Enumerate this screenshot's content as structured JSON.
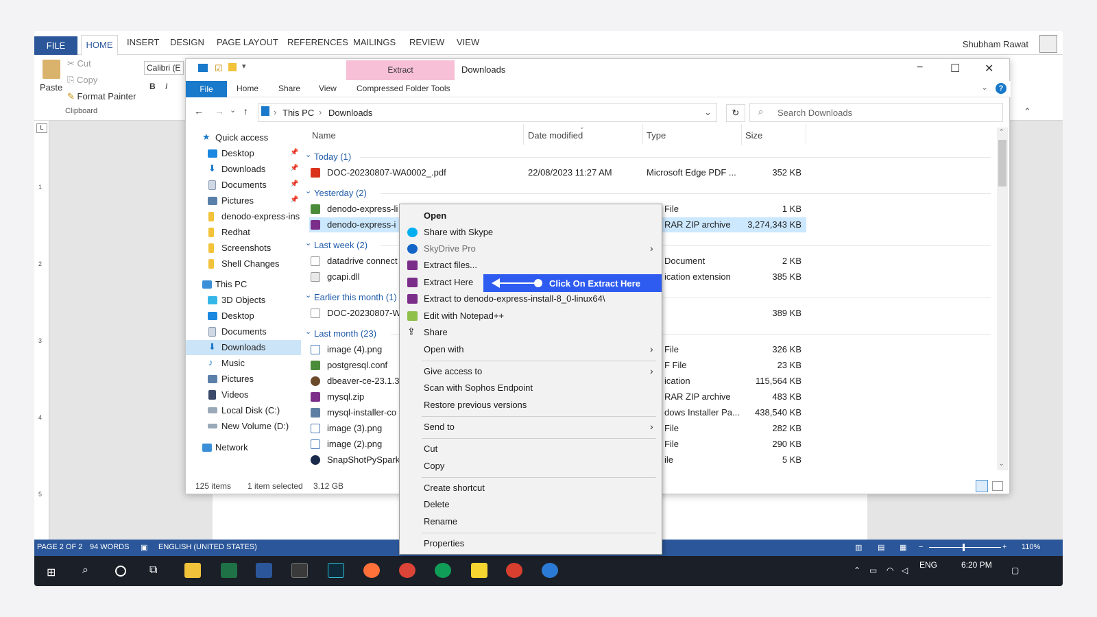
{
  "word": {
    "tabs": [
      "FILE",
      "HOME",
      "INSERT",
      "DESIGN",
      "PAGE LAYOUT",
      "REFERENCES",
      "MAILINGS",
      "REVIEW",
      "VIEW"
    ],
    "user": "Shubham Rawat",
    "clipboard": {
      "paste": "Paste",
      "cut": "Cut",
      "copy": "Copy",
      "format_painter": "Format Painter",
      "group": "Clipboard"
    },
    "font_box": "Calibri (E",
    "status": {
      "page": "PAGE 2 OF 2",
      "words": "94 WORDS",
      "lang": "ENGLISH (UNITED STATES)",
      "zoom": "110%"
    },
    "ruler_marks": [
      "1",
      "2",
      "3",
      "4",
      "5"
    ]
  },
  "taskbar": {
    "lang": "ENG",
    "time": "6:20 PM"
  },
  "explorer": {
    "title": "Downloads",
    "extract_tab": "Extract",
    "ribbon_tabs": [
      "File",
      "Home",
      "Share",
      "View",
      "Compressed Folder Tools"
    ],
    "breadcrumb": [
      "This PC",
      "Downloads"
    ],
    "search_placeholder": "Search Downloads",
    "columns": [
      "Name",
      "Date modified",
      "Type",
      "Size"
    ],
    "nav": {
      "quick_access": "Quick access",
      "quick_items": [
        "Desktop",
        "Downloads",
        "Documents",
        "Pictures",
        "denodo-express-ins",
        "Redhat",
        "Screenshots",
        "Shell Changes"
      ],
      "this_pc": "This PC",
      "pc_items": [
        "3D Objects",
        "Desktop",
        "Documents",
        "Downloads",
        "Music",
        "Pictures",
        "Videos",
        "Local Disk (C:)",
        "New Volume (D:)"
      ],
      "network": "Network"
    },
    "groups": {
      "today": "Today (1)",
      "yesterday": "Yesterday (2)",
      "last_week": "Last week (2)",
      "earlier": "Earlier this month (1)",
      "last_month": "Last month (23)"
    },
    "files": {
      "today": [
        {
          "name": "DOC-20230807-WA0002_.pdf",
          "date": "22/08/2023 11:27 AM",
          "type": "Microsoft Edge PDF ...",
          "size": "352 KB"
        }
      ],
      "yesterday": [
        {
          "name": "denodo-express-li",
          "type": "File",
          "size": "1 KB"
        },
        {
          "name": "denodo-express-i",
          "type": "RAR ZIP archive",
          "size": "3,274,343 KB"
        }
      ],
      "last_week": [
        {
          "name": "datadrive connect",
          "type": "Document",
          "size": "2 KB"
        },
        {
          "name": "gcapi.dll",
          "type": "ication extension",
          "size": "385 KB"
        }
      ],
      "earlier": [
        {
          "name": "DOC-20230807-W",
          "type": "",
          "size": "389 KB"
        }
      ],
      "last_month": [
        {
          "name": "image (4).png",
          "type": "File",
          "size": "326 KB"
        },
        {
          "name": "postgresql.conf",
          "type": "F File",
          "size": "23 KB"
        },
        {
          "name": "dbeaver-ce-23.1.3",
          "type": "ication",
          "size": "115,564 KB"
        },
        {
          "name": "mysql.zip",
          "type": "RAR ZIP archive",
          "size": "483 KB"
        },
        {
          "name": "mysql-installer-co",
          "type": "dows Installer Pa...",
          "size": "438,540 KB"
        },
        {
          "name": "image (3).png",
          "type": "File",
          "size": "282 KB"
        },
        {
          "name": "image (2).png",
          "type": "File",
          "size": "290 KB"
        },
        {
          "name": "SnapShotPySpark",
          "type": "ile",
          "size": "5 KB"
        }
      ]
    },
    "status": {
      "items": "125 items",
      "selected": "1 item selected",
      "size": "3.12 GB"
    }
  },
  "context_menu": {
    "open": "Open",
    "share_skype": "Share with Skype",
    "skydrive": "SkyDrive Pro",
    "extract_files": "Extract files...",
    "extract_here": "Extract Here",
    "extract_to": "Extract to denodo-express-install-8_0-linux64\\",
    "notepad": "Edit with Notepad++",
    "share": "Share",
    "open_with": "Open with",
    "give_access": "Give access to",
    "sophos": "Scan with Sophos Endpoint",
    "restore": "Restore previous versions",
    "send_to": "Send to",
    "cut": "Cut",
    "copy": "Copy",
    "create_shortcut": "Create shortcut",
    "delete": "Delete",
    "rename": "Rename",
    "properties": "Properties"
  },
  "callout": {
    "text": "Click On Extract Here",
    "color": "#2f5cf0"
  }
}
